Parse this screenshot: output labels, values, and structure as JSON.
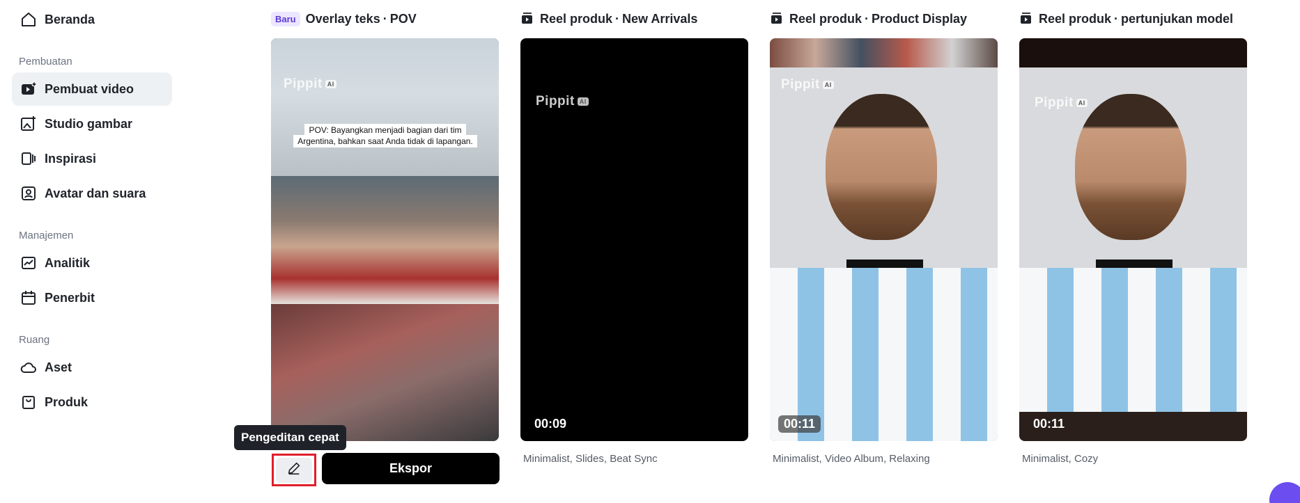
{
  "sidebar": {
    "home": {
      "label": "Beranda",
      "icon": "home-icon"
    },
    "sections": [
      {
        "title": "Pembuatan"
      },
      {
        "title": "Manajemen"
      },
      {
        "title": "Ruang"
      }
    ],
    "items": [
      {
        "label": "Pembuat video",
        "icon": "video-plus-icon",
        "active": true
      },
      {
        "label": "Studio gambar",
        "icon": "image-plus-icon"
      },
      {
        "label": "Inspirasi",
        "icon": "inspiration-icon"
      },
      {
        "label": "Avatar dan suara",
        "icon": "avatar-icon"
      },
      {
        "label": "Analitik",
        "icon": "chart-icon"
      },
      {
        "label": "Penerbit",
        "icon": "calendar-icon"
      },
      {
        "label": "Aset",
        "icon": "cloud-icon"
      },
      {
        "label": "Produk",
        "icon": "bag-icon"
      }
    ]
  },
  "cards": [
    {
      "badge": "Baru",
      "name": "Overlay teks",
      "dot": "·",
      "variant": "POV",
      "caption": "POV: Bayangkan menjadi bagian dari tim Argentina, bahkan saat Anda tidak di lapangan.",
      "watermark": "Pippit",
      "watermark_ai": "AI"
    },
    {
      "name": "Reel produk",
      "dot": "·",
      "variant": "New Arrivals",
      "duration": "00:09",
      "tags": "Minimalist, Slides, Beat Sync",
      "watermark": "Pippit",
      "watermark_ai": "AI"
    },
    {
      "name": "Reel produk",
      "dot": "·",
      "variant": "Product Display",
      "duration": "00:11",
      "tags": "Minimalist, Video Album, Relaxing",
      "watermark": "Pippit",
      "watermark_ai": "AI"
    },
    {
      "name": "Reel produk",
      "dot": "·",
      "variant": "pertunjukan model",
      "duration": "00:11",
      "tags": "Minimalist, Cozy",
      "watermark": "Pippit",
      "watermark_ai": "AI"
    }
  ],
  "actions": {
    "tooltip": "Pengeditan cepat",
    "edit_icon": "pencil-icon",
    "export_label": "Ekspor"
  },
  "colors": {
    "active_bg": "#eef1f4",
    "badge_bg": "#ece6ff",
    "badge_text": "#5b3bd6",
    "highlight_border": "#e11d2a",
    "fab": "#6b4df0"
  }
}
